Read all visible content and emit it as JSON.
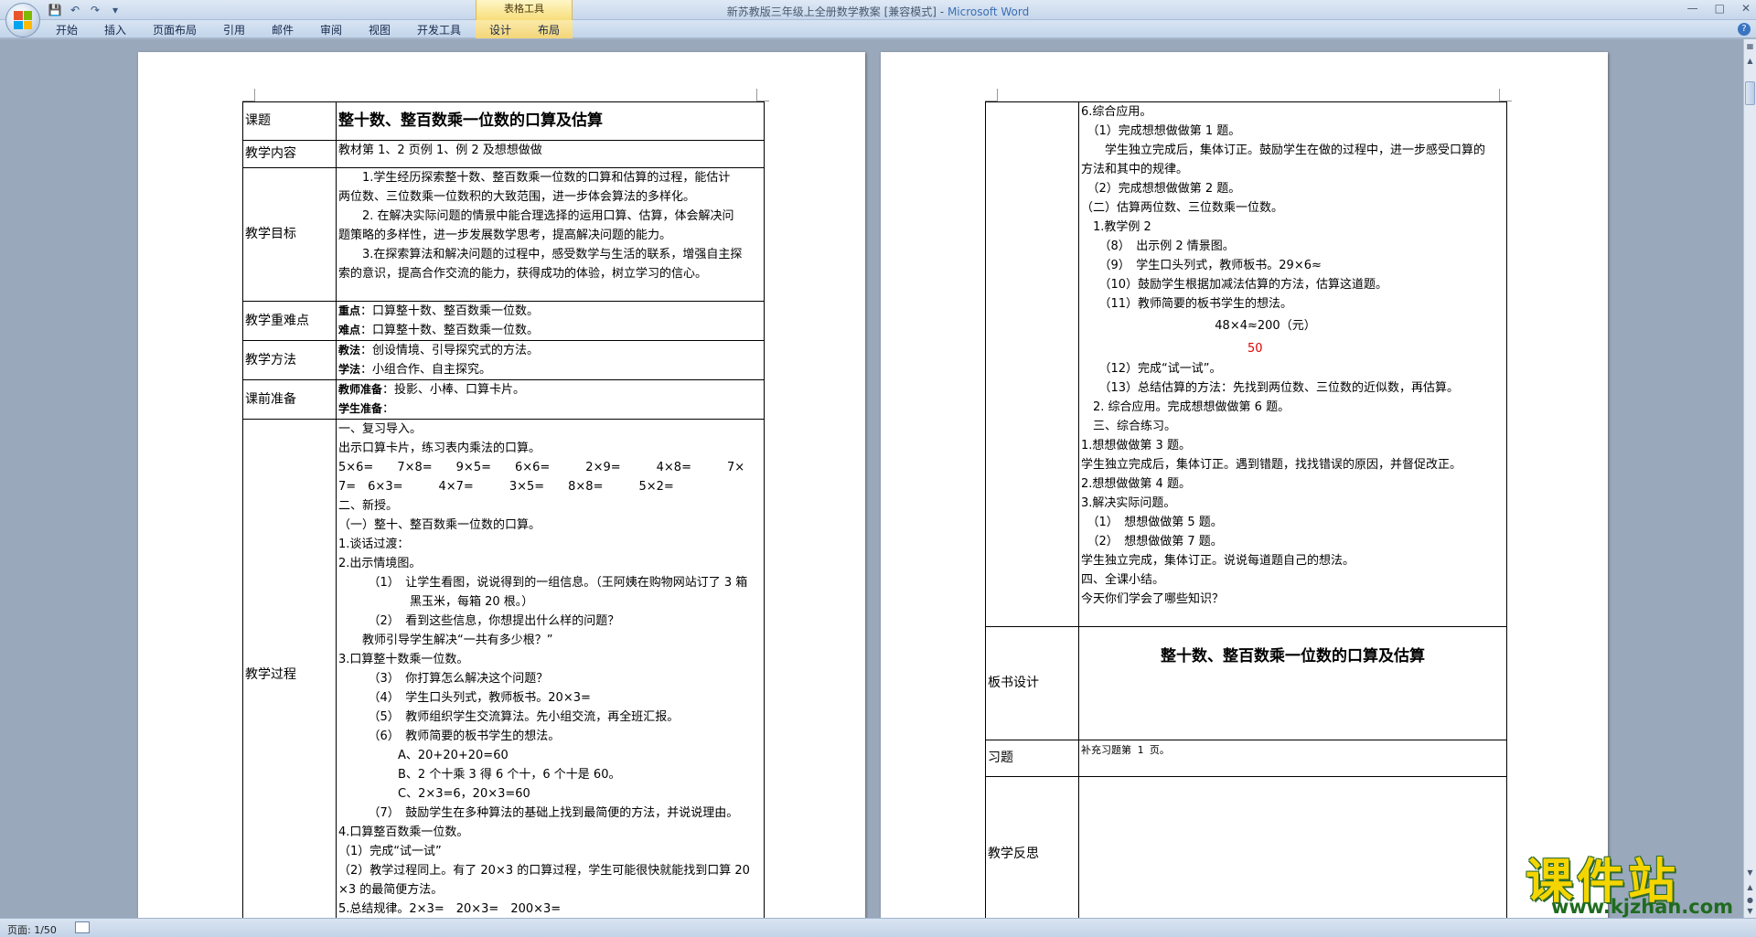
{
  "window": {
    "title": "新苏教版三年级上全册数学教案 [兼容模式]",
    "title_sep": " - ",
    "app_name": "Microsoft Word",
    "context_group": "表格工具"
  },
  "ribbon_tabs": [
    "开始",
    "插入",
    "页面布局",
    "引用",
    "邮件",
    "审阅",
    "视图",
    "开发工具",
    "设计",
    "布局"
  ],
  "status": {
    "page_info": "页面: 1/50"
  },
  "watermark": {
    "text": "课件站",
    "url": "www.kjzhan.com"
  },
  "page1": {
    "rows": {
      "topic": {
        "label": "课题",
        "value": "整十数、整百数乘一位数的口算及估算"
      },
      "content": {
        "label": "教学内容",
        "value": "教材第 1、2 页例 1、例 2 及想想做做"
      },
      "goals": {
        "label": "教学目标",
        "lines": [
          "　　1.学生经历探索整十数、整百数乘一位数的口算和估算的过程，能估计",
          "两位数、三位数乘一位数积的大致范围，进一步体会算法的多样化。",
          "　　2. 在解决实际问题的情景中能合理选择的运用口算、估算，体会解决问",
          "题策略的多样性，进一步发展数学思考，提高解决问题的能力。",
          "　　3.在探索算法和解决问题的过程中，感受数学与生活的联系，增强自主探",
          "索的意识，提高合作交流的能力，获得成功的体验，树立学习的信心。"
        ]
      },
      "keypoints": {
        "label": "教学重难点",
        "key_tag": "重点",
        "key_text": "：口算整十数、整百数乘一位数。",
        "diff_tag": "难点",
        "diff_text": "：口算整十数、整百数乘一位数。"
      },
      "methods": {
        "label": "教学方法",
        "teach_tag": "教法",
        "teach_text": "：创设情境、引导探究式的方法。",
        "learn_tag": "学法",
        "learn_text": "：小组合作、自主探究。"
      },
      "prep": {
        "label": "课前准备",
        "teacher_tag": "教师准备",
        "teacher_text": "：投影、小棒、口算卡片。",
        "student_tag": "学生准备",
        "student_text": "："
      },
      "process": {
        "label": "教学过程",
        "lines": [
          "一、复习导入。",
          "出示口算卡片，练习表内乘法的口算。",
          "5×6=　　7×8=　　9×5=　　6×6=　　　2×9=　　　4×8=　　　7×",
          "7=　6×3=　　　4×7=　　　3×5=　　8×8=　　　5×2=",
          "二、新授。",
          "（一）整十、整百数乘一位数的口算。",
          "1.谈话过渡：",
          "2.出示情境图。",
          "　　　（1）　让学生看图，说说得到的一组信息。（王阿姨在购物网站订了 3 箱",
          "　　　　　　黑玉米，每箱 20 根。）",
          "　　　（2）　看到这些信息，你想提出什么样的问题？",
          "　　教师引导学生解决“一共有多少根？”",
          "3.口算整十数乘一位数。",
          "　　　（3）　你打算怎么解决这个问题？",
          "　　　（4）　学生口头列式，教师板书。20×3=",
          "　　　（5）　教师组织学生交流算法。先小组交流，再全班汇报。",
          "　　　（6）　教师简要的板书学生的想法。",
          "　　　　　A、20+20+20=60",
          "　　　　　B、2 个十乘 3 得 6 个十，6 个十是 60。",
          "　　　　　C、2×3=6，20×3=60",
          "　　　（7）　鼓励学生在多种算法的基础上找到最简便的方法，并说说理由。",
          "4.口算整百数乘一位数。",
          "（1）完成“试一试”",
          "（2）教学过程同上。有了 20×3 的口算过程，学生可能很快就能找到口算 20",
          "×3 的最简便方法。",
          "5.总结规律。2×3=　20×3=　200×3="
        ]
      }
    }
  },
  "page2": {
    "process_cont": [
      "6.综合应用。",
      "　（1）完成想想做做第 1 题。",
      "　　学生独立完成后，集体订正。鼓励学生在做的过程中，进一步感受口算的",
      "方法和其中的规律。",
      "　（2）完成想想做做第 2 题。",
      "（二）估算两位数、三位数乘一位数。",
      "　1.教学例 2",
      "　　（8）　出示例 2 情景图。",
      "　　（9）　学生口头列式，教师板书。29×6≈",
      "　　（10）鼓励学生根据加减法估算的方法，估算这道题。",
      "　　（11）教师简要的板书学生的想法。"
    ],
    "formula": "48×4≈200（元）",
    "red_value": "50",
    "process_cont2": [
      "　　（12）完成“试一试”。",
      "　　（13）总结估算的方法：先找到两位数、三位数的近似数，再估算。",
      "　2. 综合应用。完成想想做做第 6 题。",
      "　三、综合练习。",
      "1.想想做做第 3 题。",
      "学生独立完成后，集体订正。遇到错题，找找错误的原因，并督促改正。",
      "2.想想做做第 4 题。",
      "3.解决实际问题。",
      "　（1）　想想做做第 5 题。",
      "　（2）　想想做做第 7 题。",
      "学生独立完成，集体订正。说说每道题自己的想法。",
      "四、全课小结。",
      "今天你们学会了哪些知识？"
    ],
    "board": {
      "label": "板书设计",
      "title": "整十数、整百数乘一位数的口算及估算"
    },
    "exercise": {
      "label": "习题",
      "value": "补充习题第 1 页。"
    },
    "reflection": {
      "label": "教学反思"
    }
  }
}
